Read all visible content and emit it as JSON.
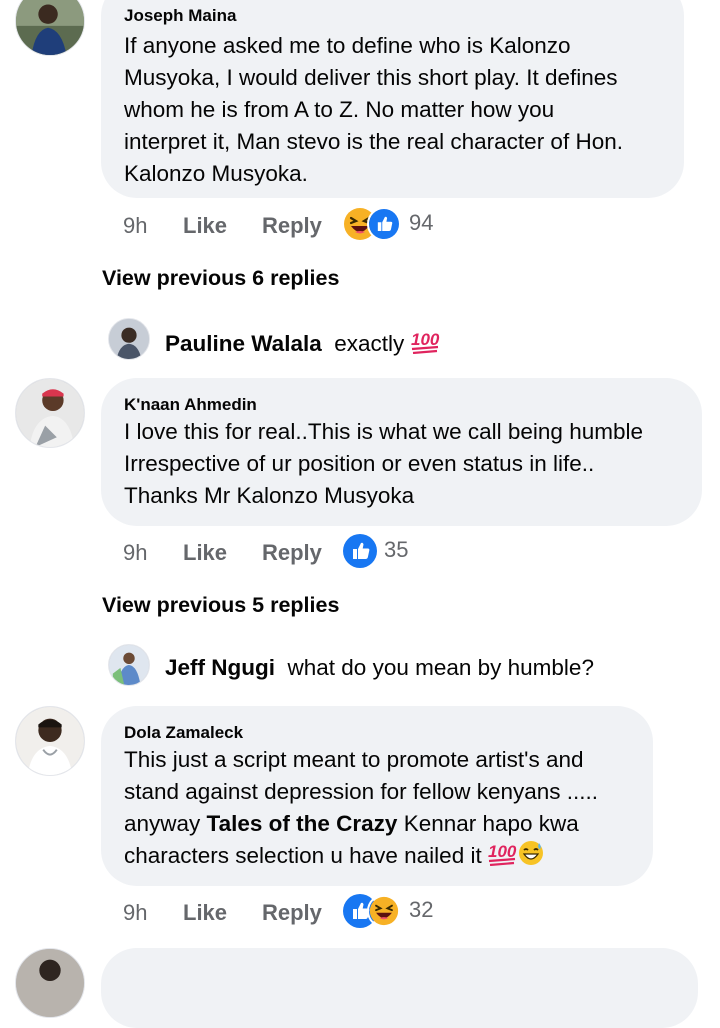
{
  "comments": [
    {
      "author": "Joseph Maina",
      "lines": [
        "If anyone asked me to define who is Kalonzo",
        "Musyoka, I would deliver this short play. It defines",
        "whom he is from A to Z. No matter how you",
        "interpret it, Man stevo is the real character of Hon.",
        "Kalonzo Musyoka."
      ],
      "time": "9h",
      "like_label": "Like",
      "reply_label": "Reply",
      "reactions": [
        "haha-emoji-icon",
        "like-icon"
      ],
      "reaction_count": "94"
    },
    {
      "author": "K'naan Ahmedin",
      "lines": [
        "I love this for real..This is what we call being humble",
        "Irrespective of ur position or even status in life..",
        "Thanks Mr Kalonzo Musyoka"
      ],
      "time": "9h",
      "like_label": "Like",
      "reply_label": "Reply",
      "reactions": [
        "like-icon"
      ],
      "reaction_count": "35"
    },
    {
      "author": "Dola Zamaleck",
      "lines": [
        "This just a script meant to promote artist's and",
        "stand against depression for fellow kenyans .....",
        "anyway ",
        "characters selection u have nailed it "
      ],
      "mention": "Tales of the Crazy",
      "mention_suffix": " Kennar hapo kwa",
      "time": "9h",
      "like_label": "Like",
      "reply_label": "Reply",
      "reactions": [
        "like-icon",
        "haha-emoji-icon"
      ],
      "reaction_count": "32"
    }
  ],
  "view_previous": [
    {
      "label": "View previous 6 replies"
    },
    {
      "label": "View previous 5 replies"
    }
  ],
  "replies": [
    {
      "author": "Pauline Walala",
      "text": "exactly "
    },
    {
      "author": "Jeff Ngugi",
      "text": "what do you mean by humble?"
    }
  ],
  "emoji": {
    "hundred": "100"
  },
  "colors": {
    "bubble_bg": "#f0f2f5",
    "meta_text": "#65676b",
    "like_blue": "#1877f2",
    "haha_yellow": "#f7b125",
    "hundred_red": "#e0245e"
  }
}
